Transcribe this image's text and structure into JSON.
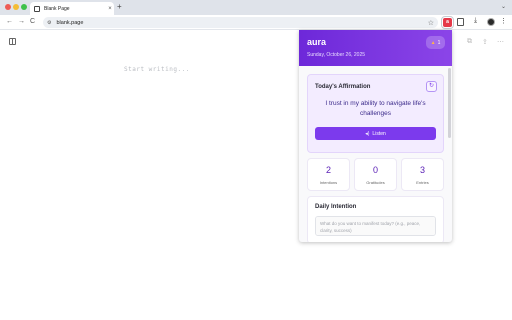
{
  "browser": {
    "tab_title": "Blank Page",
    "tab_close": "×",
    "new_tab": "+",
    "url": "blank.page",
    "accent": "#e53949"
  },
  "nav": {
    "back": "←",
    "forward": "→",
    "reload": "C",
    "star": "☆",
    "download": "⤓",
    "menu": "⋮",
    "tabstrip_menu": "⌄"
  },
  "editor": {
    "placeholder": "Start writing..."
  },
  "page_icons": {
    "copy": "⧉",
    "share": "⇪",
    "more": "⋯"
  },
  "popup": {
    "brand": "aura",
    "date": "Sunday, October 26, 2025",
    "streak_count": "1",
    "header_colors": [
      "#6d28d9",
      "#8b45e8"
    ],
    "affirmation": {
      "title": "Today's Affirmation",
      "text": "I trust in my ability to navigate life's challenges",
      "listen_label": "Listen"
    },
    "stats": [
      {
        "value": "2",
        "label": "Intentions"
      },
      {
        "value": "0",
        "label": "Gratitudes"
      },
      {
        "value": "3",
        "label": "Entries"
      }
    ],
    "intention": {
      "title": "Daily Intention",
      "placeholder": "What do you want to manifest today? (e.g., peace, clarity, success)"
    }
  }
}
